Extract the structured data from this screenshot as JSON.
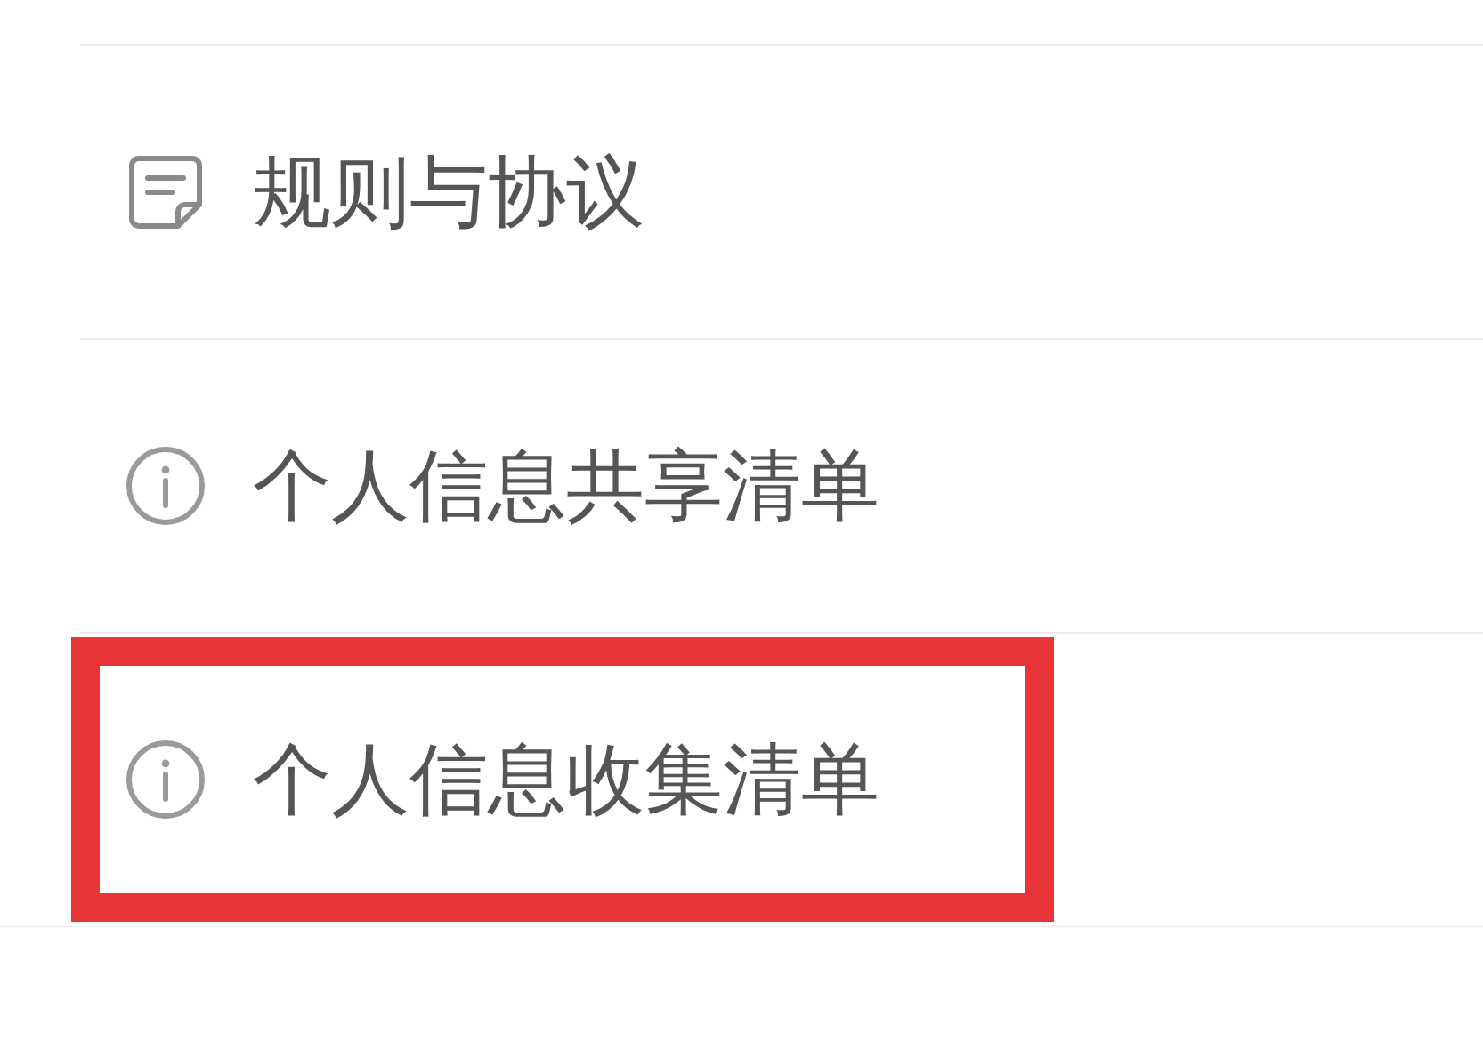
{
  "menu_items": [
    {
      "label": "规则与协议",
      "kind": "document",
      "highlighted": false
    },
    {
      "label": "个人信息共享清单",
      "kind": "info",
      "highlighted": false
    },
    {
      "label": "个人信息收集清单",
      "kind": "info",
      "highlighted": true
    }
  ]
}
